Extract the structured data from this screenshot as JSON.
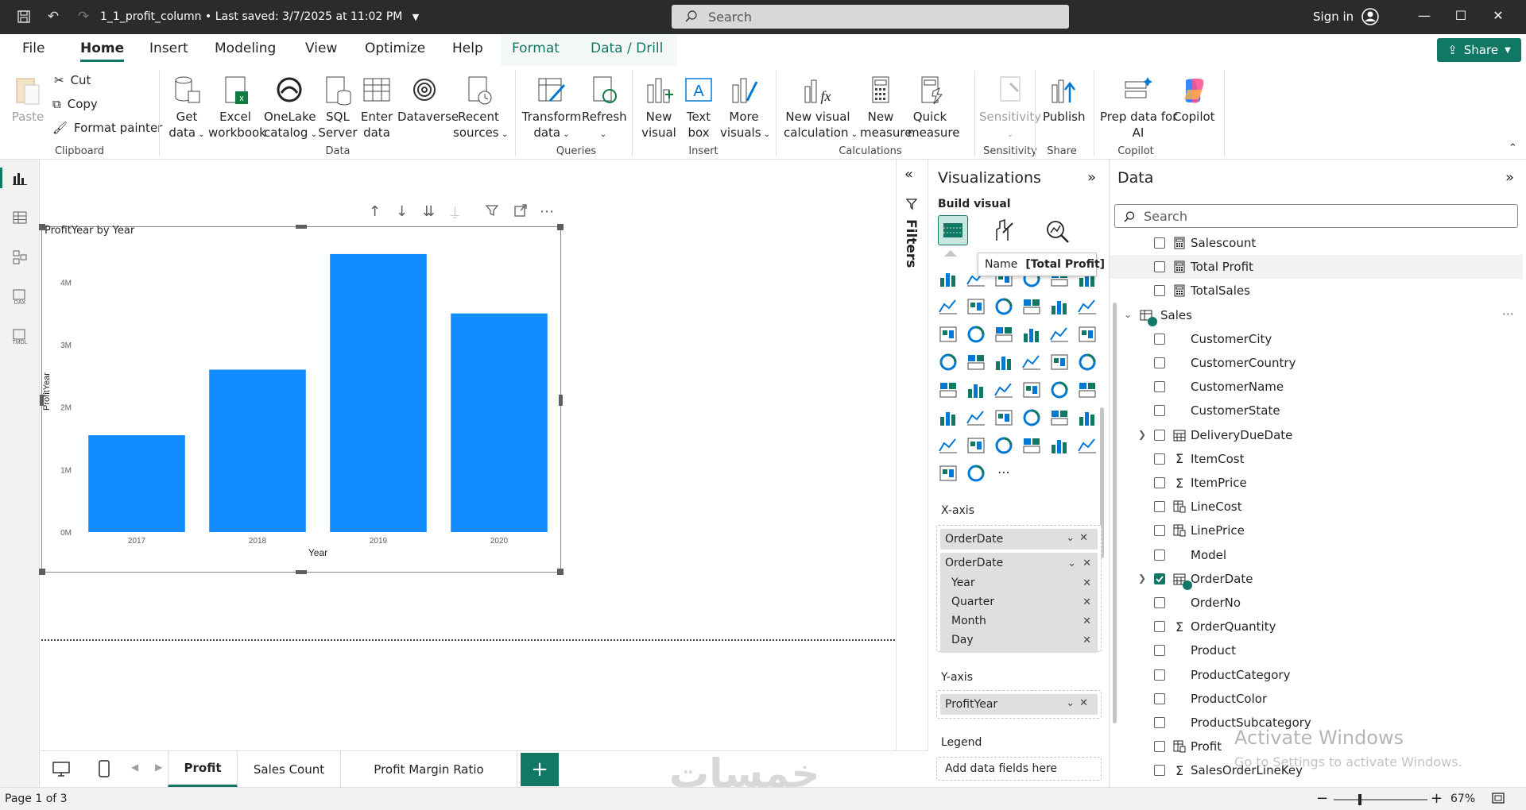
{
  "titlebar": {
    "document_title": "1_1_profit_column",
    "saved_status": "Last saved: 3/7/2025 at 11:02 PM",
    "search_placeholder": "Search",
    "signin_label": "Sign in"
  },
  "menu": {
    "tabs": [
      "File",
      "Home",
      "Insert",
      "Modeling",
      "View",
      "Optimize",
      "Help",
      "Format",
      "Data / Drill"
    ],
    "active_tab": "Home",
    "share_label": "Share"
  },
  "ribbon": {
    "clipboard": {
      "paste": "Paste",
      "cut": "Cut",
      "copy": "Copy",
      "format_painter": "Format painter",
      "group": "Clipboard"
    },
    "data": {
      "get_data": [
        "Get",
        "data"
      ],
      "excel": [
        "Excel",
        "workbook"
      ],
      "onelake": [
        "OneLake",
        "catalog"
      ],
      "sql": [
        "SQL",
        "Server"
      ],
      "enter": [
        "Enter",
        "data"
      ],
      "dataverse": "Dataverse",
      "recent": [
        "Recent",
        "sources"
      ],
      "group": "Data"
    },
    "queries": {
      "transform": [
        "Transform",
        "data"
      ],
      "refresh": "Refresh",
      "group": "Queries"
    },
    "insert": {
      "new_visual": [
        "New",
        "visual"
      ],
      "text_box": [
        "Text",
        "box"
      ],
      "more_visuals": [
        "More",
        "visuals"
      ],
      "group": "Insert"
    },
    "calculations": {
      "new_visual_calc": [
        "New visual",
        "calculation"
      ],
      "new_measure": [
        "New",
        "measure"
      ],
      "quick_measure": [
        "Quick",
        "measure"
      ],
      "group": "Calculations"
    },
    "sensitivity": {
      "label": "Sensitivity",
      "group": "Sensitivity"
    },
    "share": {
      "publish": "Publish",
      "group": "Share"
    },
    "copilot": {
      "prep": [
        "Prep data for",
        "AI"
      ],
      "copilot": "Copilot",
      "group": "Copilot"
    }
  },
  "visual": {
    "title": "ProfitYear by Year"
  },
  "chart_data": {
    "type": "bar",
    "title": "ProfitYear by Year",
    "xlabel": "Year",
    "ylabel": "ProfitYear",
    "categories": [
      "2017",
      "2018",
      "2019",
      "2020"
    ],
    "values": [
      1550000,
      2600000,
      4450000,
      3500000
    ],
    "ylim": [
      0,
      4500000
    ],
    "yticks": [
      "0M",
      "1M",
      "2M",
      "3M",
      "4M"
    ],
    "ytick_values": [
      0,
      1000000,
      2000000,
      3000000,
      4000000
    ],
    "bar_color": "#118dff",
    "grid": false,
    "legend": "none"
  },
  "filters": {
    "label": "Filters"
  },
  "viz_pane": {
    "title": "Visualizations",
    "subtitle": "Build visual",
    "tooltip_name": "Name",
    "tooltip_value": "[Total Profit]",
    "xaxis_label": "X-axis",
    "xaxis_field": "OrderDate",
    "xaxis_hierarchy": "OrderDate",
    "xaxis_levels": [
      "Year",
      "Quarter",
      "Month",
      "Day"
    ],
    "yaxis_label": "Y-axis",
    "yaxis_field": "ProfitYear",
    "legend_label": "Legend",
    "legend_placeholder": "Add data fields here"
  },
  "data_pane": {
    "title": "Data",
    "search_placeholder": "Search",
    "fields_top": [
      {
        "name": "Salescount",
        "icon": "calc",
        "checked": false
      },
      {
        "name": "Total Profit",
        "icon": "calc",
        "checked": false
      },
      {
        "name": "TotalSales",
        "icon": "calc",
        "checked": false
      }
    ],
    "table_name": "Sales",
    "fields": [
      {
        "name": "CustomerCity",
        "icon": "",
        "checked": false,
        "expand": false
      },
      {
        "name": "CustomerCountry",
        "icon": "",
        "checked": false,
        "expand": false
      },
      {
        "name": "CustomerName",
        "icon": "",
        "checked": false,
        "expand": false
      },
      {
        "name": "CustomerState",
        "icon": "",
        "checked": false,
        "expand": false
      },
      {
        "name": "DeliveryDueDate",
        "icon": "calendar",
        "checked": false,
        "expand": true
      },
      {
        "name": "ItemCost",
        "icon": "sigma",
        "checked": false,
        "expand": false
      },
      {
        "name": "ItemPrice",
        "icon": "sigma",
        "checked": false,
        "expand": false
      },
      {
        "name": "LineCost",
        "icon": "calccol",
        "checked": false,
        "expand": false
      },
      {
        "name": "LinePrice",
        "icon": "calccol",
        "checked": false,
        "expand": false
      },
      {
        "name": "Model",
        "icon": "",
        "checked": false,
        "expand": false
      },
      {
        "name": "OrderDate",
        "icon": "calendar",
        "checked": true,
        "expand": true
      },
      {
        "name": "OrderNo",
        "icon": "",
        "checked": false,
        "expand": false
      },
      {
        "name": "OrderQuantity",
        "icon": "sigma",
        "checked": false,
        "expand": false
      },
      {
        "name": "Product",
        "icon": "",
        "checked": false,
        "expand": false
      },
      {
        "name": "ProductCategory",
        "icon": "",
        "checked": false,
        "expand": false
      },
      {
        "name": "ProductColor",
        "icon": "",
        "checked": false,
        "expand": false
      },
      {
        "name": "ProductSubcategory",
        "icon": "",
        "checked": false,
        "expand": false
      },
      {
        "name": "Profit",
        "icon": "calccol",
        "checked": false,
        "expand": false
      },
      {
        "name": "SalesOrderLineKey",
        "icon": "sigma",
        "checked": false,
        "expand": false
      }
    ]
  },
  "pages": {
    "tabs": [
      "Profit",
      "Sales Count",
      "Profit Margin Ratio"
    ],
    "active": "Profit",
    "add_label": "+"
  },
  "status": {
    "page_indicator": "Page 1 of 3",
    "zoom": "67%",
    "zoom_fraction": 0.28
  },
  "watermark": {
    "line1": "Activate Windows",
    "line2": "Go to Settings to activate Windows.",
    "logo": "خمسات"
  },
  "colors": {
    "accent": "#117865",
    "bar": "#118dff",
    "titlebar": "#2b2b2b"
  }
}
